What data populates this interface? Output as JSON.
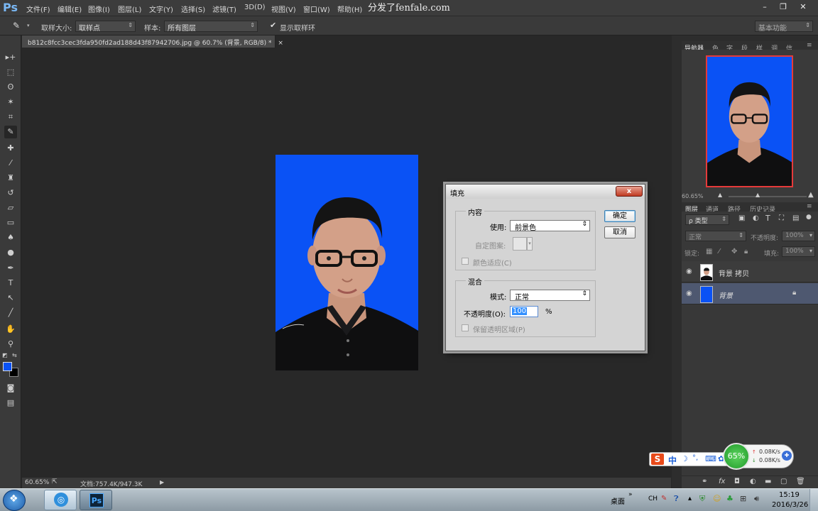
{
  "menubar": {
    "logo": "Ps",
    "items": [
      "文件(F)",
      "编辑(E)",
      "图像(I)",
      "图层(L)",
      "文字(Y)",
      "选择(S)",
      "滤镜(T)",
      "3D(D)",
      "视图(V)",
      "窗口(W)",
      "帮助(H)"
    ],
    "watermark": "分发了fenfale.com",
    "window_buttons": [
      "–",
      "❐",
      "✕"
    ]
  },
  "options": {
    "sample_size_label": "取样大小:",
    "sample_size_value": "取样点",
    "sample_label": "样本:",
    "sample_value": "所有图层",
    "show_ring_label": "显示取样环",
    "show_ring_checked": true,
    "workspace": "基本功能"
  },
  "document": {
    "tab_title": "b812c8fcc3cec3fda950fd2ad188d43f87942706.jpg @ 60.7% (背景, RGB/8) *",
    "tab_close": "×"
  },
  "status": {
    "zoom": "60.65%",
    "doc_size": "文档:757.4K/947.3K"
  },
  "navigator": {
    "tabs": [
      "导航器",
      "色",
      "字",
      "段",
      "样",
      "调",
      "信"
    ],
    "zoom": "60.65%"
  },
  "layers": {
    "tabs": [
      "图层",
      "通道",
      "路径",
      "历史记录"
    ],
    "filter_label": "ρ 类型",
    "blend_mode": "正常",
    "opacity_label": "不透明度:",
    "opacity_value": "100%",
    "lock_label": "锁定:",
    "fill_label": "填充:",
    "fill_value": "100%",
    "rows": [
      {
        "name": "背景 拷贝",
        "italic": false
      },
      {
        "name": "背景",
        "italic": true
      }
    ]
  },
  "dialog": {
    "title": "填充",
    "close": "x",
    "content_legend": "内容",
    "use_label": "使用:",
    "use_value": "前景色",
    "custom_pattern_label": "自定图案:",
    "color_adapt_label": "颜色适应(C)",
    "blend_legend": "混合",
    "mode_label": "模式:",
    "mode_value": "正常",
    "opacity_label": "不透明度(O):",
    "opacity_value": "100",
    "percent": "%",
    "preserve_label": "保留透明区域(P)",
    "ok_label": "确定",
    "cancel_label": "取消"
  },
  "ime": {
    "logo": "S",
    "mode": "中",
    "percent": "65%",
    "up_speed": "0.08K/s",
    "down_speed": "0.08K/s"
  },
  "taskbar": {
    "desktop_label": "桌面",
    "ps_label": "Ps",
    "lang": "CH",
    "time": "15:19",
    "date": "2016/3/26"
  },
  "colors": {
    "accent": "#0a52f5",
    "foreground": "#0a52f5",
    "background": "#000000"
  }
}
